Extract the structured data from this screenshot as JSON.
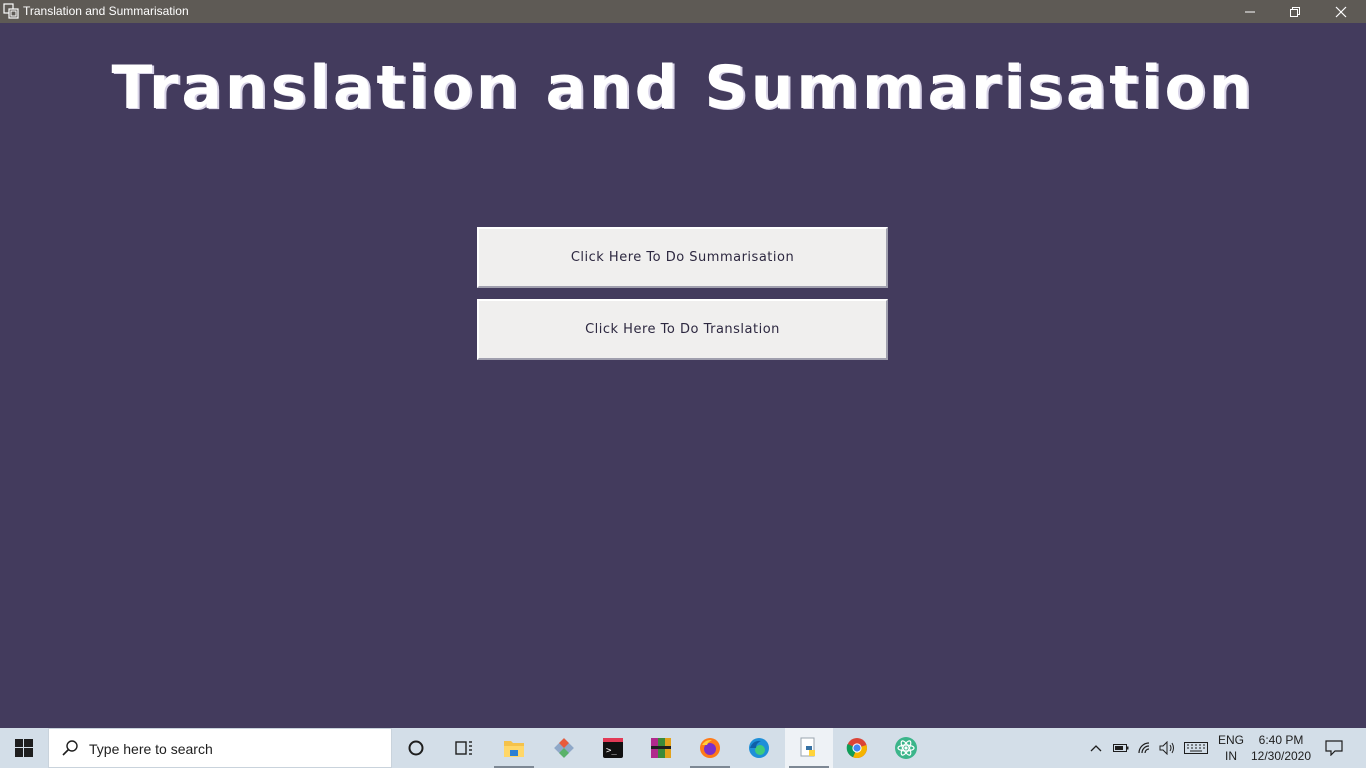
{
  "window": {
    "title": "Translation and Summarisation",
    "controls": [
      "minimize-icon",
      "restore-icon",
      "close-icon"
    ]
  },
  "main": {
    "heading": "Translation and Summarisation",
    "buttons": {
      "summarisation": "Click Here To Do Summarisation",
      "translation": "Click Here To Do Translation"
    }
  },
  "taskbar": {
    "search_placeholder": "Type here to search",
    "apps": [
      "cortana-icon",
      "task-view-icon",
      "file-explorer-icon",
      "git-icon",
      "terminal-icon",
      "winrar-icon",
      "firefox-icon",
      "edge-icon",
      "python-icon",
      "chrome-icon",
      "atom-icon"
    ],
    "language": {
      "line1": "ENG",
      "line2": "IN"
    },
    "clock": {
      "time": "6:40 PM",
      "date": "12/30/2020"
    }
  },
  "colors": {
    "background": "#433b5d",
    "titlebar": "#5e5a55",
    "button_face": "#f0efee",
    "taskbar": "#d3dee8"
  }
}
